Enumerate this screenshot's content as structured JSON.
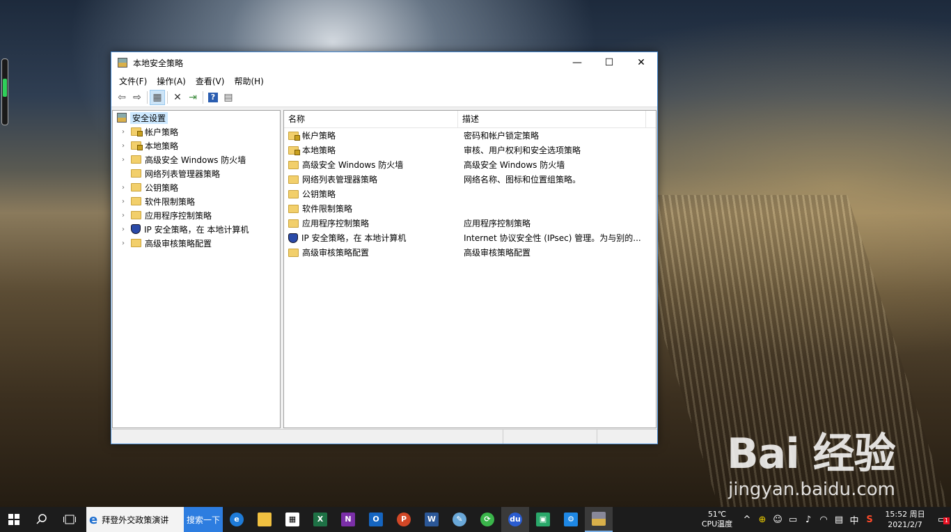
{
  "window": {
    "title": "本地安全策略",
    "controls": {
      "minimize": "—",
      "maximize": "☐",
      "close": "✕"
    }
  },
  "menu": [
    "文件(F)",
    "操作(A)",
    "查看(V)",
    "帮助(H)"
  ],
  "toolbar_icons": [
    "back-arrow-icon",
    "forward-arrow-icon",
    "show-hide-tree-icon",
    "delete-icon",
    "export-list-icon",
    "help-icon",
    "properties-icon"
  ],
  "tree": {
    "root": "安全设置",
    "items": [
      {
        "label": "帐户策略",
        "expandable": true,
        "icon": "folder-lock-icon"
      },
      {
        "label": "本地策略",
        "expandable": true,
        "icon": "folder-lock-icon"
      },
      {
        "label": "高级安全 Windows 防火墙",
        "expandable": true,
        "icon": "folder-icon"
      },
      {
        "label": "网络列表管理器策略",
        "expandable": false,
        "icon": "folder-icon"
      },
      {
        "label": "公钥策略",
        "expandable": true,
        "icon": "folder-icon"
      },
      {
        "label": "软件限制策略",
        "expandable": true,
        "icon": "folder-icon"
      },
      {
        "label": "应用程序控制策略",
        "expandable": true,
        "icon": "folder-icon"
      },
      {
        "label": "IP 安全策略，在 本地计算机",
        "expandable": true,
        "icon": "ip-security-icon"
      },
      {
        "label": "高级审核策略配置",
        "expandable": true,
        "icon": "folder-icon"
      }
    ]
  },
  "list": {
    "headers": {
      "name": "名称",
      "description": "描述"
    },
    "rows": [
      {
        "name": "帐户策略",
        "description": "密码和帐户锁定策略"
      },
      {
        "name": "本地策略",
        "description": "审核、用户权利和安全选项策略"
      },
      {
        "name": "高级安全 Windows 防火墙",
        "description": "高级安全 Windows 防火墙"
      },
      {
        "name": "网络列表管理器策略",
        "description": "网络名称、图标和位置组策略。"
      },
      {
        "name": "公钥策略",
        "description": ""
      },
      {
        "name": "软件限制策略",
        "description": ""
      },
      {
        "name": "应用程序控制策略",
        "description": "应用程序控制策略"
      },
      {
        "name": "IP 安全策略，在 本地计算机",
        "description": "Internet 协议安全性 (IPsec) 管理。为与别的..."
      },
      {
        "name": "高级审核策略配置",
        "description": "高级审核策略配置"
      }
    ]
  },
  "taskbar": {
    "search_text": "拜登外交政策演讲",
    "search_button": "搜索一下",
    "cpu_temp": "51℃",
    "cpu_label": "CPU温度",
    "ime": "中",
    "time": "15:52 周日",
    "date": "2021/2/7",
    "notification_count": "1"
  },
  "watermark": {
    "logo": "Bai 经验",
    "url": "jingyan.baidu.com"
  }
}
